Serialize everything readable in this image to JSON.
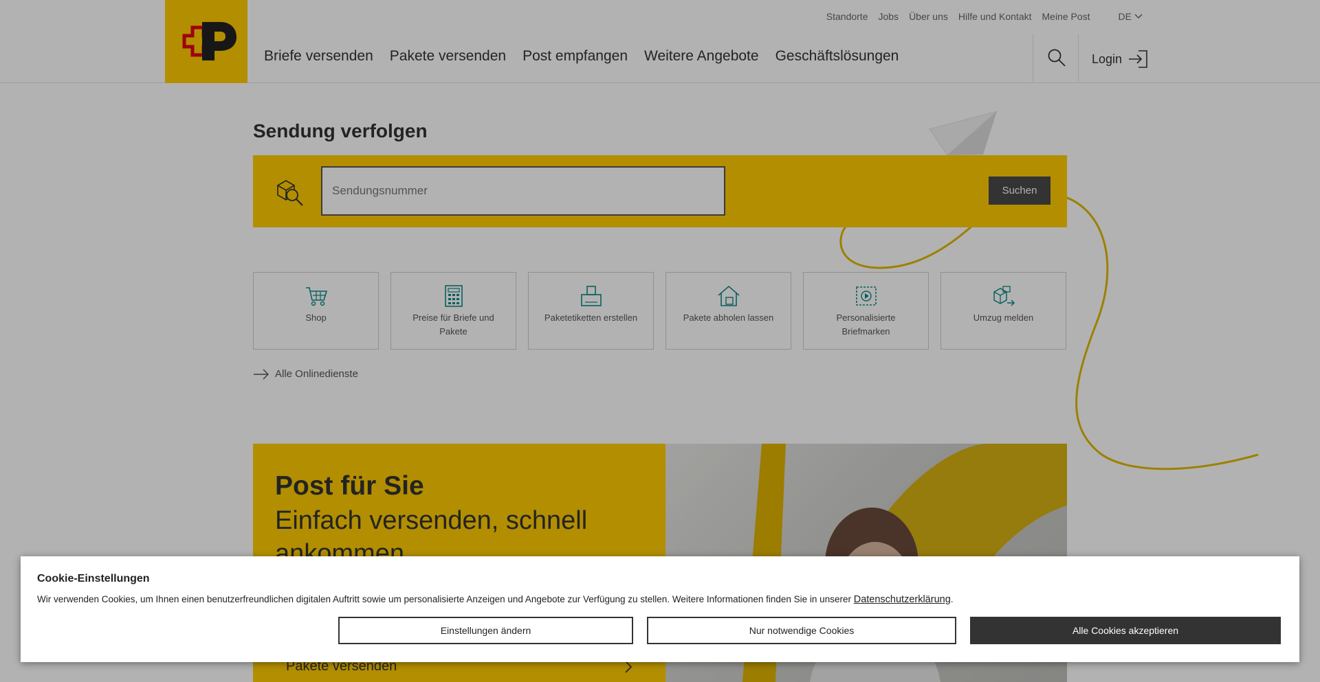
{
  "header": {
    "top_links": [
      "Standorte",
      "Jobs",
      "Über uns",
      "Hilfe und Kontakt",
      "Meine Post"
    ],
    "language": "DE",
    "main_nav": [
      "Briefe versenden",
      "Pakete versenden",
      "Post empfangen",
      "Weitere Angebote",
      "Geschäftslösungen"
    ],
    "login_label": "Login"
  },
  "tracking": {
    "title": "Sendung verfolgen",
    "placeholder": "Sendungsnummer",
    "submit_label": "Suchen"
  },
  "services": {
    "tiles": [
      {
        "label": "Shop",
        "icon": "cart-icon"
      },
      {
        "label": "Preise für Briefe und Pakete",
        "icon": "calculator-icon"
      },
      {
        "label": "Paketetiketten erstellen",
        "icon": "package-label-icon"
      },
      {
        "label": "Pakete abholen lassen",
        "icon": "house-package-icon"
      },
      {
        "label": "Personalisierte Briefmarken",
        "icon": "stamp-icon"
      },
      {
        "label": "Umzug melden",
        "icon": "moving-boxes-icon"
      }
    ],
    "all_services_label": "Alle Onlinedienste"
  },
  "hero": {
    "title": "Post für Sie",
    "subtitle": "Einfach versenden, schnell ankommen",
    "link_label": "Pakete versenden"
  },
  "cookie": {
    "title": "Cookie-Einstellungen",
    "text": "Wir verwenden Cookies, um Ihnen einen benutzerfreundlichen digitalen Auftritt sowie um personalisierte Anzeigen und Angebote zur Verfügung zu stellen. Weitere Informationen finden Sie in unserer ",
    "link_label": "Datenschutzerklärung",
    "text_end": ".",
    "settings_label": "Einstellungen ändern",
    "necessary_label": "Nur notwendige Cookies",
    "accept_label": "Alle Cookies akzeptieren"
  },
  "colors": {
    "brand_yellow": "#ffcc00",
    "brand_red": "#e2001a",
    "icon_teal": "#0e8a8a",
    "dark": "#333333"
  }
}
